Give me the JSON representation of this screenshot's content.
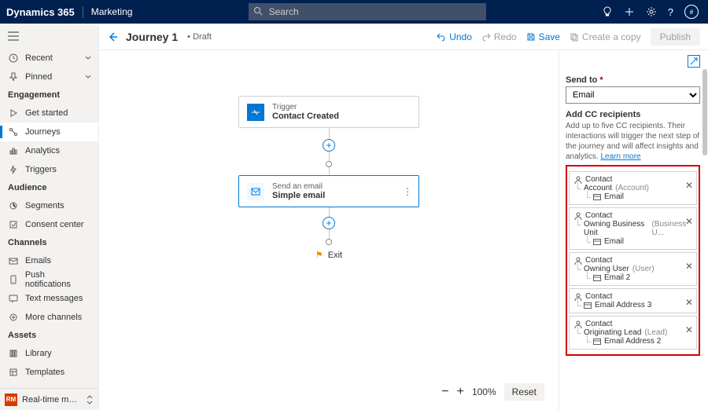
{
  "header": {
    "brand": "Dynamics 365",
    "module": "Marketing",
    "search_placeholder": "Search",
    "avatar_initial": "#"
  },
  "sidebar": {
    "recent": "Recent",
    "pinned": "Pinned",
    "groups": [
      {
        "title": "Engagement",
        "items": [
          {
            "icon": "play",
            "label": "Get started"
          },
          {
            "icon": "journey",
            "label": "Journeys",
            "active": true
          },
          {
            "icon": "analytics",
            "label": "Analytics"
          },
          {
            "icon": "trigger",
            "label": "Triggers"
          }
        ]
      },
      {
        "title": "Audience",
        "items": [
          {
            "icon": "segment",
            "label": "Segments"
          },
          {
            "icon": "consent",
            "label": "Consent center"
          }
        ]
      },
      {
        "title": "Channels",
        "items": [
          {
            "icon": "mail",
            "label": "Emails"
          },
          {
            "icon": "push",
            "label": "Push notifications"
          },
          {
            "icon": "msg",
            "label": "Text messages"
          },
          {
            "icon": "more",
            "label": "More channels"
          }
        ]
      },
      {
        "title": "Assets",
        "items": [
          {
            "icon": "lib",
            "label": "Library"
          },
          {
            "icon": "tmpl",
            "label": "Templates"
          }
        ]
      }
    ],
    "bottom_badge": "RM",
    "bottom_label": "Real-time marketi..."
  },
  "cmdbar": {
    "title": "Journey 1",
    "status": "Draft",
    "undo": "Undo",
    "redo": "Redo",
    "save": "Save",
    "copy": "Create a copy",
    "publish": "Publish"
  },
  "canvas": {
    "trigger_kicker": "Trigger",
    "trigger_label": "Contact Created",
    "email_kicker": "Send an email",
    "email_label": "Simple email",
    "exit": "Exit",
    "zoom_pct": "100%",
    "reset": "Reset"
  },
  "panel": {
    "send_to": "Send to",
    "send_to_value": "Email",
    "cc_title": "Add CC recipients",
    "cc_help_1": "Add up to five CC recipients. Their interactions will trigger the next step of the journey and will affect insights and analytics. ",
    "cc_help_link": "Learn more",
    "cards": [
      {
        "top": "Contact",
        "mid": "Account",
        "mid_gray": "(Account)",
        "leaf": "Email"
      },
      {
        "top": "Contact",
        "mid": "Owning Business Unit",
        "mid_gray": "(Business U...",
        "leaf": "Email"
      },
      {
        "top": "Contact",
        "mid": "Owning User",
        "mid_gray": "(User)",
        "leaf": "Email 2"
      },
      {
        "top": "Contact",
        "mid": "",
        "mid_gray": "",
        "leaf": "Email Address 3"
      },
      {
        "top": "Contact",
        "mid": "Originating Lead",
        "mid_gray": "(Lead)",
        "leaf": "Email Address 2"
      }
    ]
  }
}
